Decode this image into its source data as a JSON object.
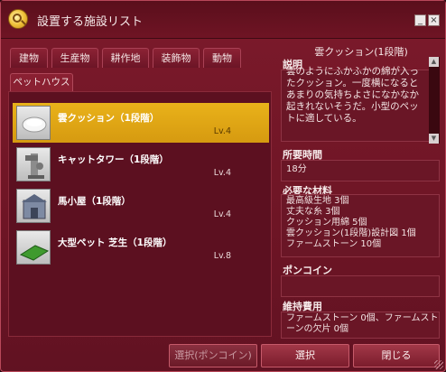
{
  "window": {
    "title": "設置する施設リスト"
  },
  "tabs": [
    {
      "label": "建物"
    },
    {
      "label": "生産物"
    },
    {
      "label": "耕作地"
    },
    {
      "label": "装飾物"
    },
    {
      "label": "動物"
    }
  ],
  "subtab": {
    "label": "ペットハウス"
  },
  "items": [
    {
      "name": "雲クッション（1段階）",
      "level": "Lv.4",
      "icon": "cloud-cushion-icon",
      "selected": true
    },
    {
      "name": "キャットタワー（1段階）",
      "level": "Lv.4",
      "icon": "cat-tower-icon",
      "selected": false
    },
    {
      "name": "馬小屋（1段階）",
      "level": "Lv.4",
      "icon": "stable-icon",
      "selected": false
    },
    {
      "name": "大型ペット 芝生（1段階）",
      "level": "Lv.8",
      "icon": "pet-lawn-icon",
      "selected": false
    }
  ],
  "detail": {
    "title": "雲クッション(1段階)",
    "description_label": "説明",
    "description": "雲のようにふかふかの綿が入ったクッション。一度横になるとあまりの気持ちよさになかなか起きれないそうだ。小型のペットに適している。",
    "time_label": "所要時間",
    "time_value": "18分",
    "materials_label": "必要な材料",
    "materials": [
      "最高級生地 3個",
      "丈夫な糸 3個",
      "クッション用綿 5個",
      "雲クッション(1段階)設計図 1個",
      "ファームストーン 10個"
    ],
    "poncoin_label": "ポンコイン",
    "upkeep_label": "維持費用",
    "upkeep_value": "ファームストーン 0個、ファームストーンの欠片 0個"
  },
  "footer": {
    "select_poncoin": "選択(ポンコイン)",
    "select": "選択",
    "close": "閉じる"
  },
  "colors": {
    "accent": "#e2a814",
    "window": "#6e1525",
    "panel": "#5c1020"
  }
}
